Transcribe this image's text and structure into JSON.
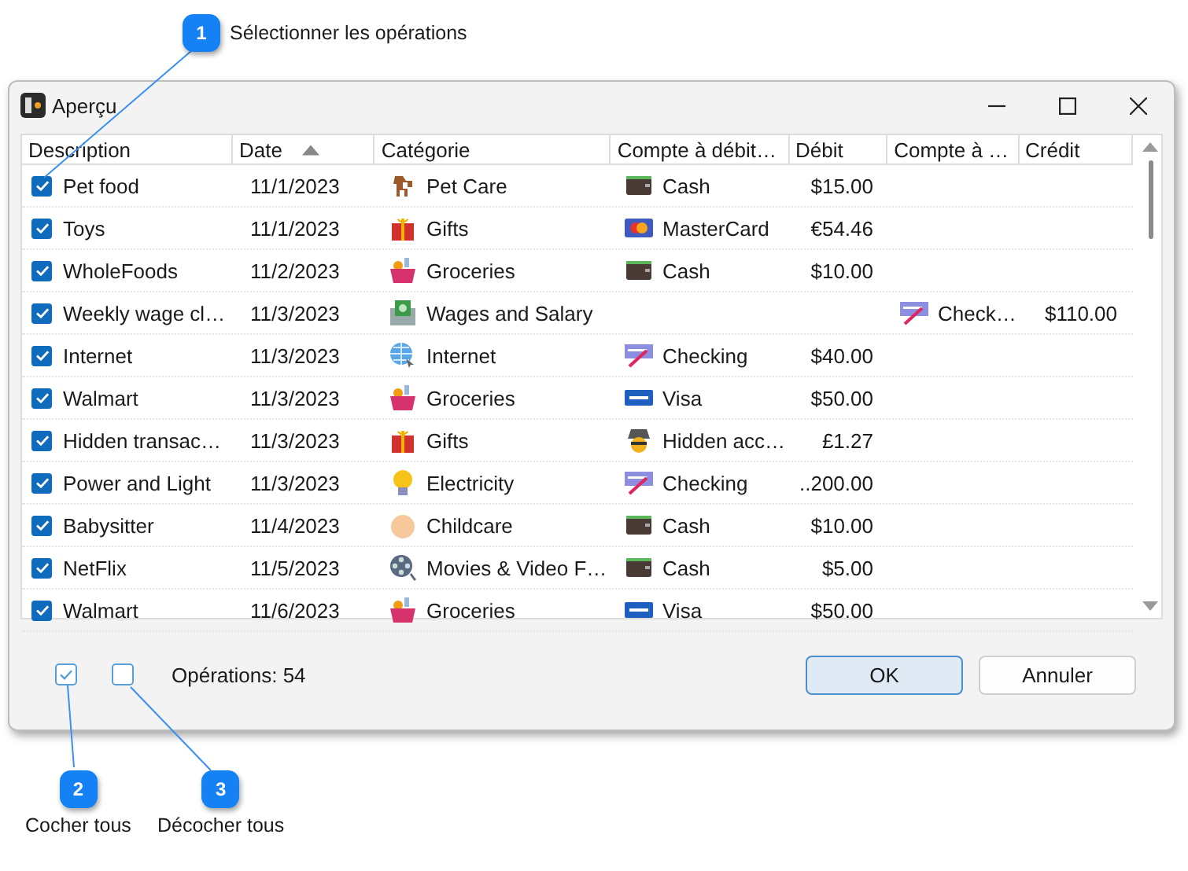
{
  "callouts": [
    {
      "number": "1",
      "label": "Sélectionner les opérations"
    },
    {
      "number": "2",
      "label": "Cocher tous"
    },
    {
      "number": "3",
      "label": "Décocher tous"
    }
  ],
  "window": {
    "title": "Aperçu"
  },
  "table": {
    "columns": [
      {
        "label": "Description",
        "sorted": false
      },
      {
        "label": "Date",
        "sorted": true
      },
      {
        "label": "Catégorie",
        "sorted": false
      },
      {
        "label": "Compte à débit…",
        "sorted": false
      },
      {
        "label": "Débit",
        "sorted": false
      },
      {
        "label": "Compte à …",
        "sorted": false
      },
      {
        "label": "Crédit",
        "sorted": false
      }
    ],
    "rows": [
      {
        "checked": true,
        "description": "Pet food",
        "date": "11/1/2023",
        "category": {
          "kind": "pet",
          "label": "Pet Care"
        },
        "debit_account": {
          "kind": "cash",
          "label": "Cash"
        },
        "debit": "$15.00"
      },
      {
        "checked": true,
        "description": "Toys",
        "date": "11/1/2023",
        "category": {
          "kind": "gift",
          "label": "Gifts"
        },
        "debit_account": {
          "kind": "mastercard",
          "label": "MasterCard"
        },
        "debit": "€54.46"
      },
      {
        "checked": true,
        "description": "WholeFoods",
        "date": "11/2/2023",
        "category": {
          "kind": "groceries",
          "label": "Groceries"
        },
        "debit_account": {
          "kind": "cash",
          "label": "Cash"
        },
        "debit": "$10.00"
      },
      {
        "checked": true,
        "description": "Weekly wage cl…",
        "date": "11/3/2023",
        "category": {
          "kind": "wages",
          "label": "Wages and Salary"
        },
        "credit_account": {
          "kind": "checking",
          "label": "Check…"
        },
        "credit": "$110.00"
      },
      {
        "checked": true,
        "description": "Internet",
        "date": "11/3/2023",
        "category": {
          "kind": "internet",
          "label": "Internet"
        },
        "debit_account": {
          "kind": "checking",
          "label": "Checking"
        },
        "debit": "$40.00"
      },
      {
        "checked": true,
        "description": "Walmart",
        "date": "11/3/2023",
        "category": {
          "kind": "groceries",
          "label": "Groceries"
        },
        "debit_account": {
          "kind": "visa",
          "label": "Visa"
        },
        "debit": "$50.00"
      },
      {
        "checked": true,
        "description": "Hidden transac…",
        "date": "11/3/2023",
        "category": {
          "kind": "gift",
          "label": "Gifts"
        },
        "debit_account": {
          "kind": "hidden",
          "label": "Hidden acc…"
        },
        "debit": "£1.27"
      },
      {
        "checked": true,
        "description": "Power and Light",
        "date": "11/3/2023",
        "category": {
          "kind": "electricity",
          "label": "Electricity"
        },
        "debit_account": {
          "kind": "checking",
          "label": "Checking"
        },
        "debit": "..200.00"
      },
      {
        "checked": true,
        "description": "Babysitter",
        "date": "11/4/2023",
        "category": {
          "kind": "childcare",
          "label": "Childcare"
        },
        "debit_account": {
          "kind": "cash",
          "label": "Cash"
        },
        "debit": "$10.00"
      },
      {
        "checked": true,
        "description": "NetFlix",
        "date": "11/5/2023",
        "category": {
          "kind": "movies",
          "label": "Movies & Video F…"
        },
        "debit_account": {
          "kind": "cash",
          "label": "Cash"
        },
        "debit": "$5.00"
      },
      {
        "checked": true,
        "description": "Walmart",
        "date": "11/6/2023",
        "category": {
          "kind": "groceries",
          "label": "Groceries"
        },
        "debit_account": {
          "kind": "visa",
          "label": "Visa"
        },
        "debit": "$50.00"
      }
    ]
  },
  "footer": {
    "count": "Opérations: 54"
  },
  "buttons": [
    {
      "label": "OK",
      "default": true
    },
    {
      "label": "Annuler",
      "default": false
    }
  ]
}
